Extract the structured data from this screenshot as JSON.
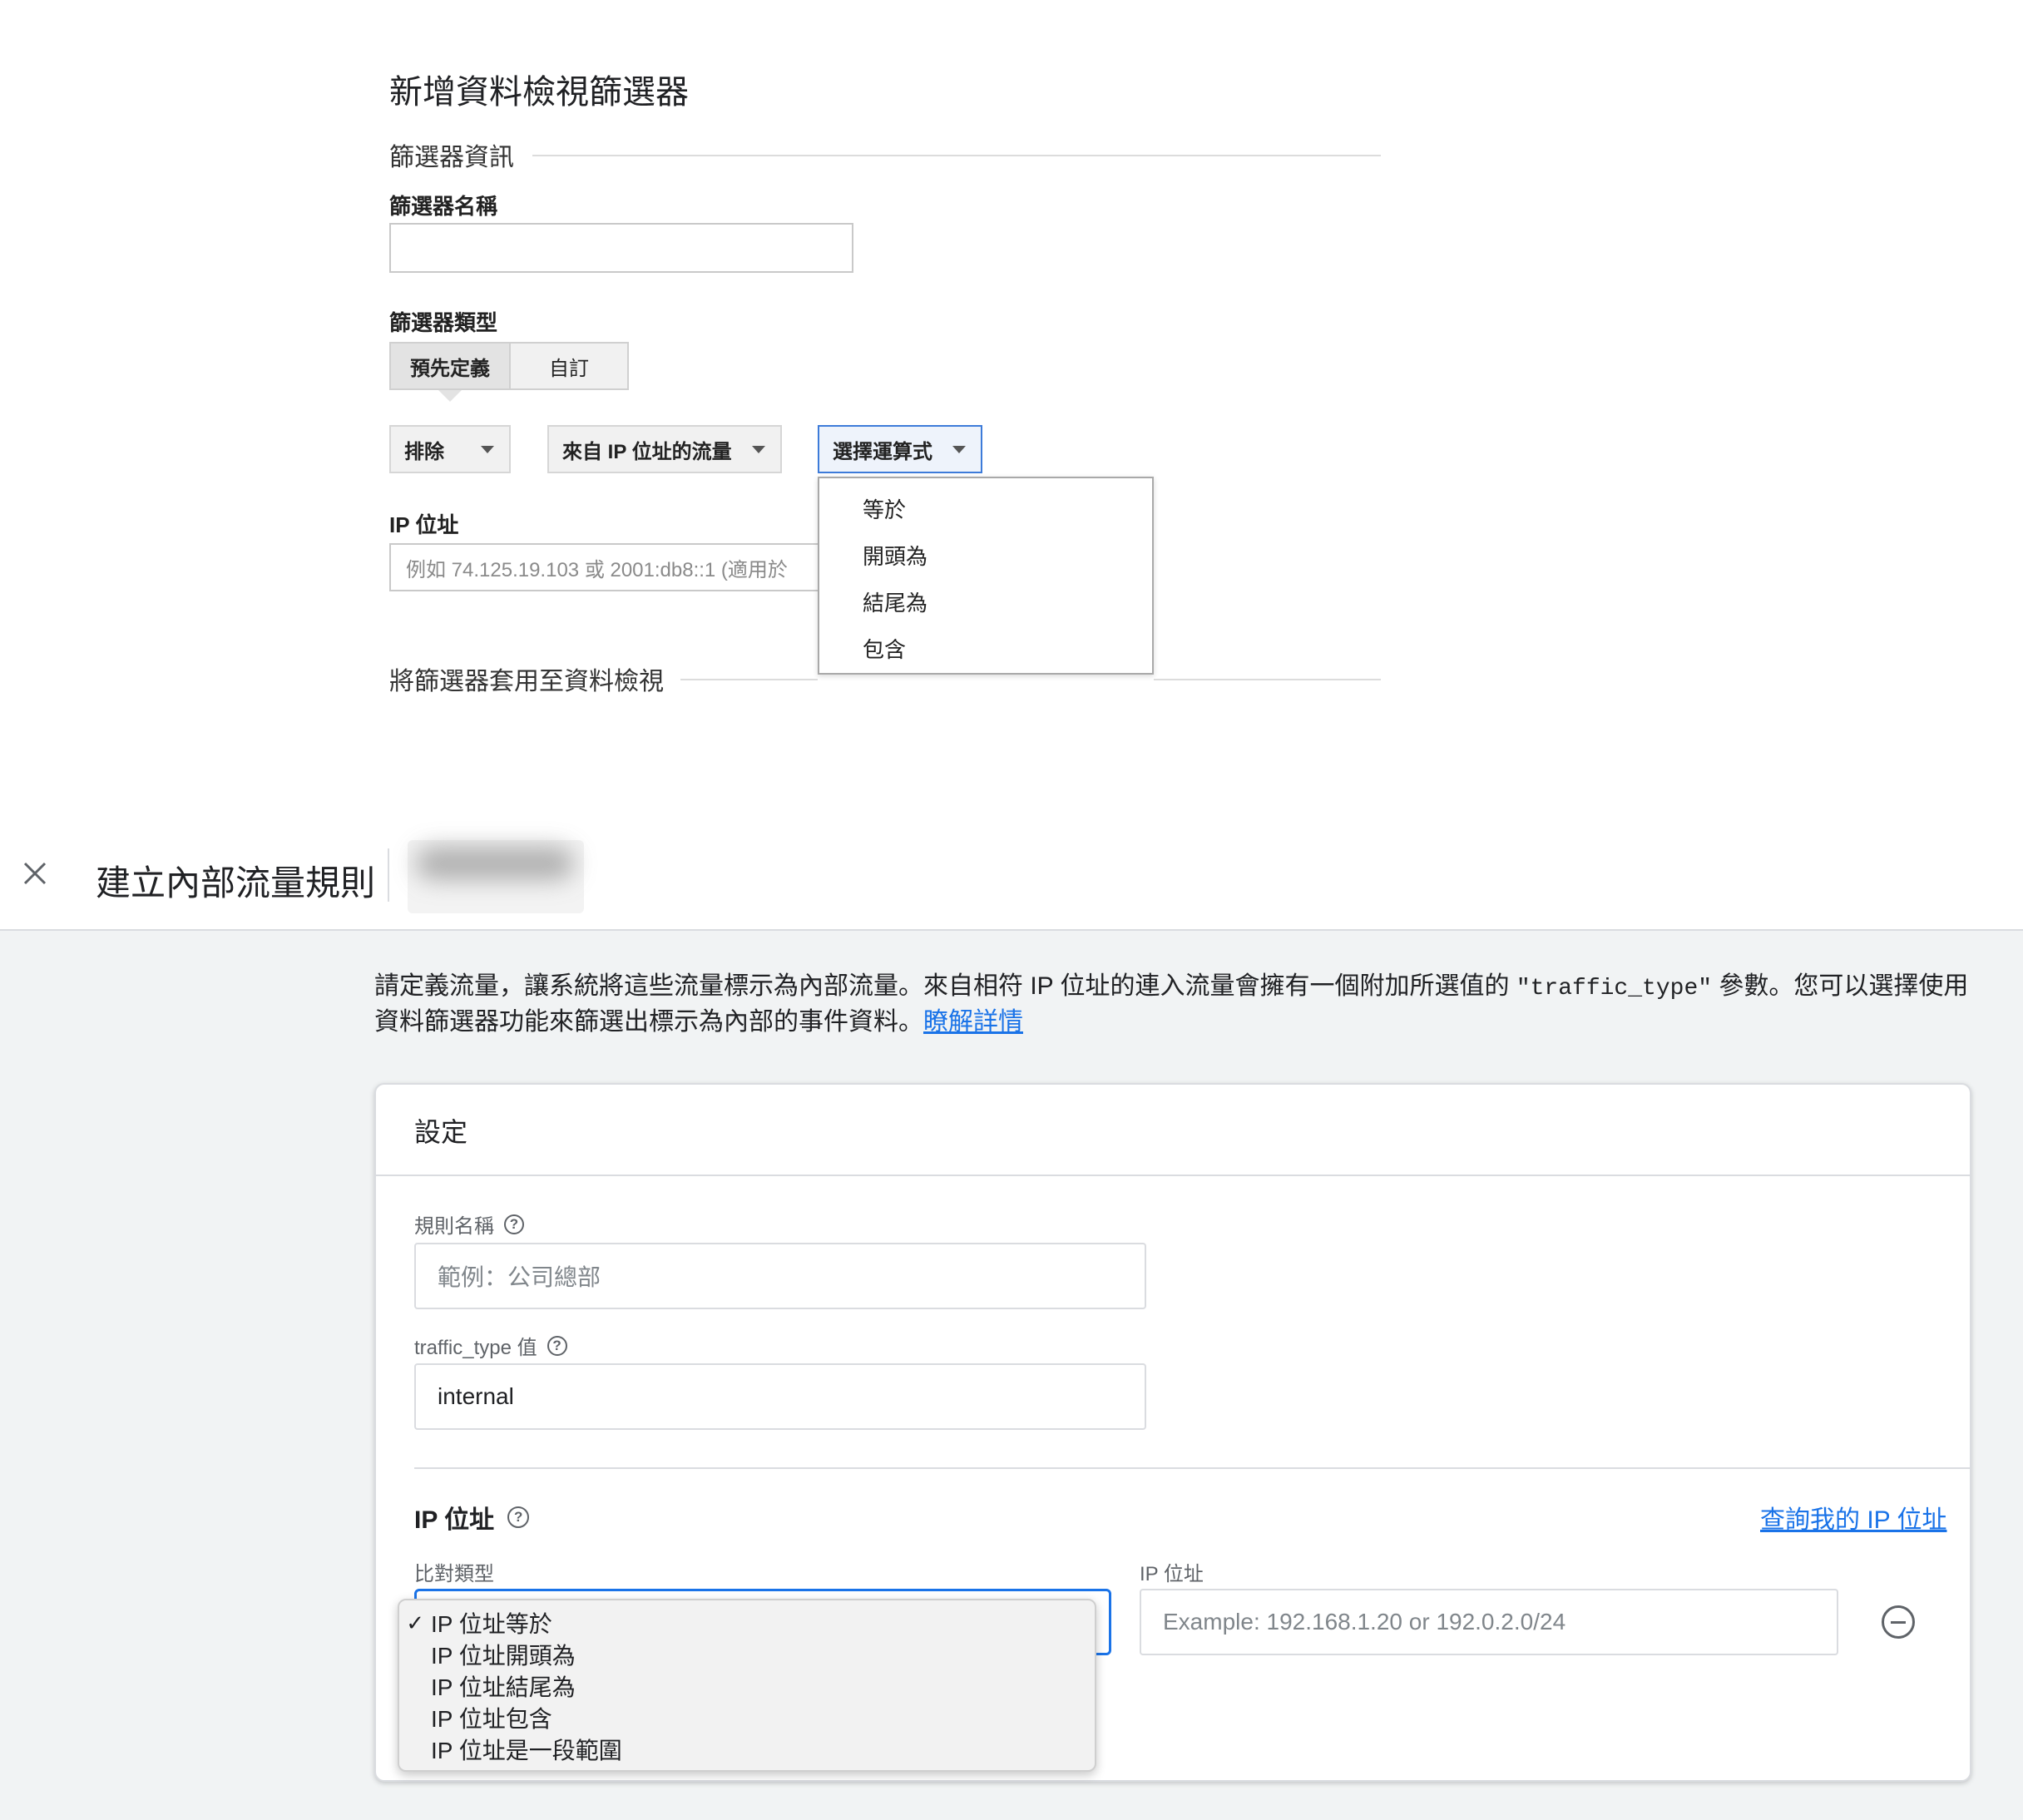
{
  "view_filter": {
    "title": "新增資料檢視篩選器",
    "section_info": "篩選器資訊",
    "name_label": "篩選器名稱",
    "name_value": "",
    "type_label": "篩選器類型",
    "type_tabs": [
      "預先定義",
      "自訂"
    ],
    "selected_tab": "預先定義",
    "dropdown_action": "排除",
    "dropdown_source": "來自 IP 位址的流量",
    "dropdown_operator": "選擇運算式",
    "operator_options": [
      "等於",
      "開頭為",
      "結尾為",
      "包含"
    ],
    "ip_label": "IP 位址",
    "ip_placeholder": "例如 74.125.19.103 或 2001:db8::1 (適用於",
    "section_apply": "將篩選器套用至資料檢視"
  },
  "internal_rule": {
    "header_title": "建立內部流量規則",
    "description_part1": "請定義流量，讓系統將這些流量標示為內部流量。來自相符 IP 位址的連入流量會擁有一個附加所選值的 ",
    "description_code": "\"traffic_type\"",
    "description_part2": " 參數。您可以選擇使用資料篩選器功能來篩選出標示為內部的事件資料。",
    "learn_more": "瞭解詳情",
    "card_title": "設定",
    "rule_name_label": "規則名稱",
    "rule_name_placeholder": "範例：公司總部",
    "traffic_type_label": "traffic_type 值",
    "traffic_type_value": "internal",
    "ip_section_title": "IP 位址",
    "lookup_link": "查詢我的 IP 位址",
    "match_type_label": "比對類型",
    "ip_field_label": "IP 位址",
    "ip_placeholder": "Example: 192.168.1.20 or 192.0.2.0/24",
    "match_type_options": [
      {
        "label": "IP 位址等於",
        "checkmark": "✓"
      },
      {
        "label": "IP 位址開頭為",
        "checkmark": ""
      },
      {
        "label": "IP 位址結尾為",
        "checkmark": ""
      },
      {
        "label": "IP 位址包含",
        "checkmark": ""
      },
      {
        "label": "IP 位址是一段範圍",
        "checkmark": ""
      }
    ]
  },
  "icons": {
    "close": "close-icon",
    "help": "help-circle-icon",
    "remove": "remove-circle-icon",
    "dropdown": "caret-down-icon"
  },
  "colors": {
    "link": "#1a73e8",
    "focus_border": "#1a73e8",
    "page_bg": "#f1f3f4"
  }
}
